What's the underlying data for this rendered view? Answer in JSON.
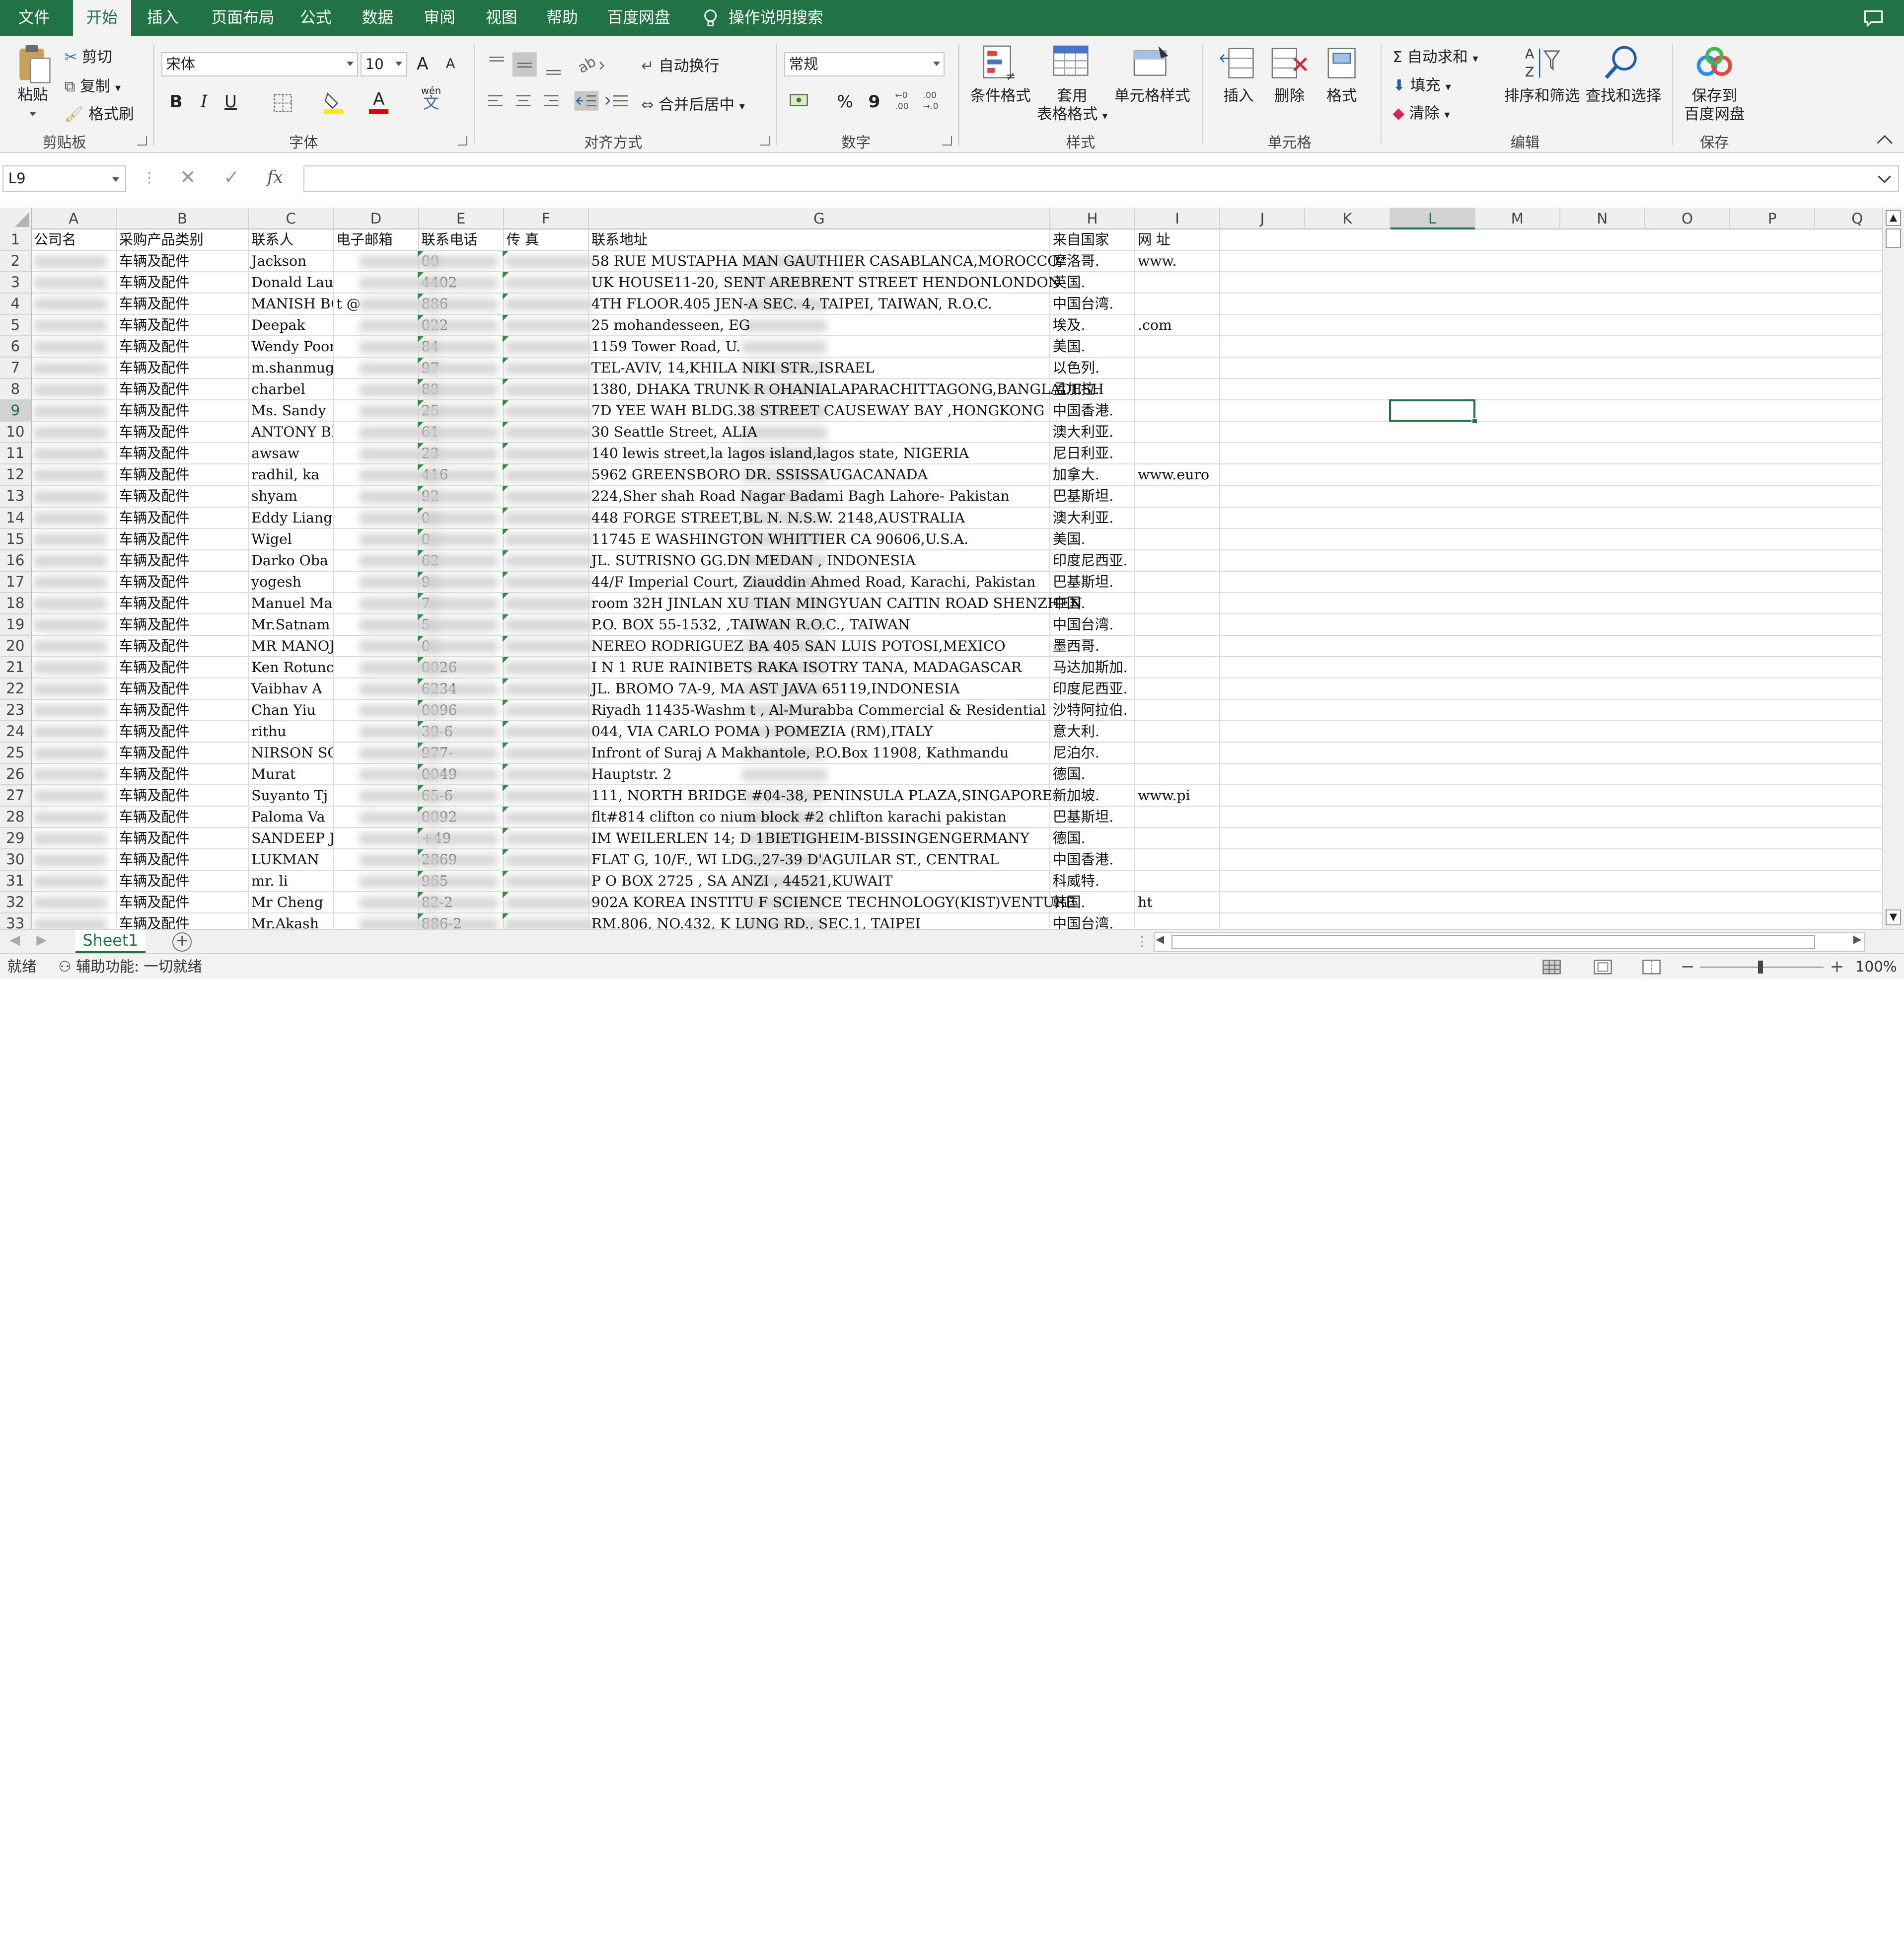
{
  "menu": {
    "items": [
      "文件",
      "开始",
      "插入",
      "页面布局",
      "公式",
      "数据",
      "审阅",
      "视图",
      "帮助",
      "百度网盘"
    ],
    "active": "开始",
    "search_placeholder": "操作说明搜索"
  },
  "ribbon": {
    "clipboard": {
      "paste": "粘贴",
      "cut": "剪切",
      "copy": "复制",
      "format_painter": "格式刷",
      "label": "剪贴板"
    },
    "font": {
      "name": "宋体",
      "size": "10",
      "grow": "A",
      "shrink": "A",
      "bold": "B",
      "italic": "I",
      "underline": "U",
      "font_color_glyph": "A",
      "phonetic": "wén",
      "phonetic_glyph": "文",
      "label": "字体"
    },
    "alignment": {
      "wrap": "自动换行",
      "merge": "合并后居中",
      "label": "对齐方式"
    },
    "number": {
      "format": "常规",
      "percent": "%",
      "comma": "9",
      "label": "数字"
    },
    "styles": {
      "conditional": "条件格式",
      "table_line1": "套用",
      "table_line2": "表格格式",
      "cell_styles": "单元格样式",
      "label": "样式"
    },
    "cells": {
      "insert": "插入",
      "delete": "删除",
      "format": "格式",
      "label": "单元格"
    },
    "editing": {
      "autosum": "自动求和",
      "fill": "填充",
      "clear": "清除",
      "sort_filter": "排序和筛选",
      "find_select": "查找和选择",
      "label": "编辑"
    },
    "save": {
      "line1": "保存到",
      "line2": "百度网盘",
      "label": "保存"
    }
  },
  "formula_bar": {
    "name_box": "L9",
    "fx": "fx",
    "value": ""
  },
  "columns": [
    "A",
    "B",
    "C",
    "D",
    "E",
    "F",
    "G",
    "H",
    "I",
    "J",
    "K",
    "L",
    "M",
    "N",
    "O",
    "P",
    "Q"
  ],
  "selected_column": "L",
  "selected_row": 9,
  "rows": [
    {
      "n": "1",
      "a": "公司名",
      "b": "采购产品类别",
      "c": "联系人",
      "d": "电子邮箱",
      "e": "联系电话",
      "f": "传    真",
      "g": "联系地址",
      "h": "来自国家",
      "i": "网    址"
    },
    {
      "n": "2",
      "a": "",
      "b": "车辆及配件",
      "c": "Jackson",
      "d": "",
      "e": "00",
      "f": "",
      "g": "58 RUE MUSTAPHA MAN     GAUTHIER CASABLANCA,MOROCCO",
      "h": "摩洛哥.",
      "i": "www."
    },
    {
      "n": "3",
      "a": "",
      "b": "车辆及配件",
      "c": "Donald Lau",
      "d": "",
      "e": "4402",
      "f": "",
      "g": "UK HOUSE11-20, SENT      AREBRENT STREET HENDONLONDON",
      "h": "英国.",
      "i": ""
    },
    {
      "n": "4",
      "a": "",
      "b": "车辆及配件",
      "c": "MANISH BOH",
      "d": "t    @",
      "e": "886",
      "f": "",
      "g": "4TH FLOOR.405 JEN-A      SEC. 4, TAIPEI, TAIWAN, R.O.C.",
      "h": "中国台湾.",
      "i": ""
    },
    {
      "n": "5",
      "a": "",
      "b": "车辆及配件",
      "c": "Deepak",
      "d": "",
      "e": "022",
      "f": "",
      "g": "25 mohandesseen, EG",
      "h": "埃及.",
      "i": ".com"
    },
    {
      "n": "6",
      "a": "",
      "b": "车辆及配件",
      "c": "Wendy Poor",
      "d": "",
      "e": "84",
      "f": "",
      "g": "1159 Tower Road, U.",
      "h": "美国.",
      "i": ""
    },
    {
      "n": "7",
      "a": "",
      "b": "车辆及配件",
      "c": "m.shanmuga",
      "d": "",
      "e": "97",
      "f": "",
      "g": "TEL-AVIV, 14,KHILA    NIKI STR.,ISRAEL",
      "h": "以色列.",
      "i": ""
    },
    {
      "n": "8",
      "a": "",
      "b": "车辆及配件",
      "c": "charbel",
      "d": "",
      "e": "88",
      "f": "",
      "g": "1380, DHAKA TRUNK R    OHANIALAPARACHITTAGONG,BANGLADESH",
      "h": "孟加拉.",
      "i": ""
    },
    {
      "n": "9",
      "a": "",
      "b": "车辆及配件",
      "c": "Ms. Sandy",
      "d": "",
      "e": "25",
      "f": "",
      "g": "7D YEE WAH BLDG.38      STREET CAUSEWAY BAY ,HONGKONG",
      "h": "中国香港.",
      "i": ""
    },
    {
      "n": "10",
      "a": "",
      "b": "车辆及配件",
      "c": "ANTONY BIE",
      "d": "",
      "e": "61",
      "f": "",
      "g": "30 Seattle Street,      ALIA",
      "h": "澳大利亚.",
      "i": ""
    },
    {
      "n": "11",
      "a": "",
      "b": "车辆及配件",
      "c": "awsaw",
      "d": "",
      "e": "23",
      "f": "",
      "g": "140 lewis street,la    lagos island,lagos state, NIGERIA",
      "h": "尼日利亚.",
      "i": ""
    },
    {
      "n": "12",
      "a": "",
      "b": "车辆及配件",
      "c": "radhil, ka",
      "d": "",
      "e": "416",
      "f": "",
      "g": "5962 GREENSBORO DR.     SSISSAUGACANADA",
      "h": "加拿大.",
      "i": "www.euro"
    },
    {
      "n": "13",
      "a": "",
      "b": "车辆及配件",
      "c": "shyam",
      "d": "",
      "e": "92",
      "f": "",
      "g": "224,Sher shah Road     Nagar Badami Bagh Lahore- Pakistan",
      "h": "巴基斯坦.",
      "i": ""
    },
    {
      "n": "14",
      "a": "",
      "b": "车辆及配件",
      "c": "Eddy Liang",
      "d": "",
      "e": "0",
      "f": "",
      "g": "448 FORGE STREET,BL      N. N.S.W. 2148,AUSTRALIA",
      "h": "澳大利亚.",
      "i": ""
    },
    {
      "n": "15",
      "a": "",
      "b": "车辆及配件",
      "c": "Wigel",
      "d": "",
      "e": "0",
      "f": "",
      "g": "11745 E WASHINGTON      WHITTIER CA 90606,U.S.A.",
      "h": "美国.",
      "i": ""
    },
    {
      "n": "16",
      "a": "",
      "b": "车辆及配件",
      "c": "Darko Oba",
      "d": "",
      "e": "62",
      "f": "",
      "g": "JL. SUTRISNO GG.DN      MEDAN , INDONESIA",
      "h": "印度尼西亚.",
      "i": ""
    },
    {
      "n": "17",
      "a": "",
      "b": "车辆及配件",
      "c": "yogesh",
      "d": "",
      "e": "9",
      "f": "",
      "g": "44/F Imperial Court,    Ziauddin Ahmed Road, Karachi, Pakistan",
      "h": "巴基斯坦.",
      "i": ""
    },
    {
      "n": "18",
      "a": "",
      "b": "车辆及配件",
      "c": "Manuel Ma",
      "d": "",
      "e": "7",
      "f": "",
      "g": "room 32H JINLAN XU    TIAN MINGYUAN CAITIN ROAD SHENZHEN",
      "h": "中国.",
      "i": ""
    },
    {
      "n": "19",
      "a": "",
      "b": "车辆及配件",
      "c": "Mr.Satnam",
      "d": "",
      "e": "5",
      "f": "",
      "g": "P.O. BOX 55-1532,      ,TAIWAN R.O.C., TAIWAN",
      "h": "中国台湾.",
      "i": ""
    },
    {
      "n": "20",
      "a": "",
      "b": "车辆及配件",
      "c": "MR MANOJ D",
      "d": "",
      "e": "0",
      "f": "",
      "g": "NEREO RODRIGUEZ BA      405 SAN LUIS POTOSI,MEXICO",
      "h": "墨西哥.",
      "i": ""
    },
    {
      "n": "21",
      "a": "",
      "b": "车辆及配件",
      "c": "Ken Rotunc",
      "d": "",
      "e": "0026",
      "f": "",
      "g": "I N 1 RUE RAINIBETS    RAKA ISOTRY TANA, MADAGASCAR",
      "h": "马达加斯加.",
      "i": ""
    },
    {
      "n": "22",
      "a": "",
      "b": "车辆及配件",
      "c": "Vaibhav A",
      "d": "",
      "e": "6234",
      "f": "",
      "g": "JL. BROMO 7A-9, MA     AST JAVA 65119,INDONESIA",
      "h": "印度尼西亚.",
      "i": ""
    },
    {
      "n": "23",
      "a": "",
      "b": "车辆及配件",
      "c": "Chan Yiu",
      "d": "",
      "e": "0096",
      "f": "",
      "g": "Riyadh 11435-Washm      t , Al-Murabba Commercial & Residential",
      "h": "沙特阿拉伯.",
      "i": ""
    },
    {
      "n": "24",
      "a": "",
      "b": "车辆及配件",
      "c": "rithu",
      "d": "",
      "e": "39-6",
      "f": "",
      "g": "044, VIA CARLO POMA      ) POMEZIA (RM),ITALY",
      "h": "意大利.",
      "i": ""
    },
    {
      "n": "25",
      "a": "",
      "b": "车辆及配件",
      "c": "NIRSON SCH",
      "d": "",
      "e": "977-",
      "f": "",
      "g": "Infront of Suraj A      Makhantole, P.O.Box 11908, Kathmandu",
      "h": "尼泊尔.",
      "i": ""
    },
    {
      "n": "26",
      "a": "",
      "b": "车辆及配件",
      "c": "Murat",
      "d": "",
      "e": "0049",
      "f": "",
      "g": "Hauptstr. 2",
      "h": "德国.",
      "i": ""
    },
    {
      "n": "27",
      "a": "",
      "b": "车辆及配件",
      "c": "Suyanto Tj",
      "d": "",
      "e": "65-6",
      "f": "",
      "g": "111, NORTH BRIDGE      #04-38, PENINSULA PLAZA,SINGAPORE",
      "h": "新加坡.",
      "i": "www.pi"
    },
    {
      "n": "28",
      "a": "",
      "b": "车辆及配件",
      "c": "Paloma Va",
      "d": "",
      "e": "0092",
      "f": "",
      "g": "flt#814 clifton co     nium block #2 chlifton karachi pakistan",
      "h": "巴基斯坦.",
      "i": ""
    },
    {
      "n": "29",
      "a": "",
      "b": "车辆及配件",
      "c": "SANDEEP JA",
      "d": "",
      "e": "+49",
      "f": "",
      "g": "IM WEILERLEN 14; D    1BIETIGHEIM-BISSINGENGERMANY",
      "h": "德国.",
      "i": ""
    },
    {
      "n": "30",
      "a": "",
      "b": "车辆及配件",
      "c": "LUKMAN",
      "d": "",
      "e": "2869",
      "f": "",
      "g": "FLAT G, 10/F., WI      LDG.,27-39 D'AGUILAR ST., CENTRAL",
      "h": "中国香港.",
      "i": ""
    },
    {
      "n": "31",
      "a": "",
      "b": "车辆及配件",
      "c": "mr. li",
      "d": "",
      "e": "965",
      "f": "",
      "g": "P O BOX 2725 , SA      ANZI , 44521,KUWAIT",
      "h": "科威特.",
      "i": ""
    },
    {
      "n": "32",
      "a": "",
      "b": "车辆及配件",
      "c": "Mr Cheng",
      "d": "",
      "e": "82-2",
      "f": "",
      "g": "902A KOREA INSTITU     F SCIENCE TECHNOLOGY(KIST)VENTURE",
      "h": "韩国.",
      "i": "ht"
    },
    {
      "n": "33",
      "a": "",
      "b": "车辆及配件",
      "c": "Mr.Akash",
      "d": "",
      "e": "886-2",
      "f": "",
      "g": "RM.806, NO.432, K     LUNG RD., SEC.1, TAIPEI",
      "h": "中国台湾.",
      "i": ""
    }
  ],
  "sheet_tab": "Sheet1",
  "status": {
    "ready": "就绪",
    "accessibility": "辅助功能: 一切就绪",
    "zoom": "100%"
  }
}
